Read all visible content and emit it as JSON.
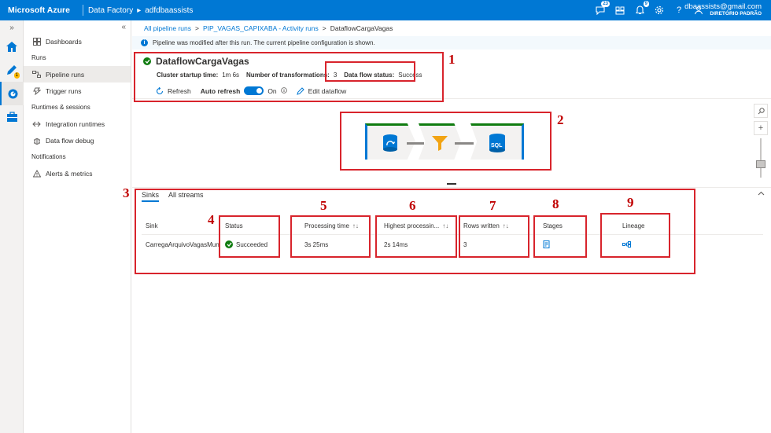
{
  "topbar": {
    "brand": "Microsoft Azure",
    "service": "Data Factory",
    "factory": "adfdbaassists",
    "notification_counts": {
      "messages": "23",
      "alerts": "9"
    },
    "user_email": "dbaassists@gmail.com",
    "user_directory": "DIRETÓRIO PADRÃO"
  },
  "rail": {
    "pen_badge": "1"
  },
  "nav": {
    "collapse": "«",
    "expand": "»",
    "items": [
      {
        "label": "Dashboards"
      },
      {
        "group": "Runs"
      },
      {
        "label": "Pipeline runs"
      },
      {
        "label": "Trigger runs"
      },
      {
        "group": "Runtimes & sessions"
      },
      {
        "label": "Integration runtimes"
      },
      {
        "label": "Data flow debug"
      },
      {
        "group": "Notifications"
      },
      {
        "label": "Alerts & metrics"
      }
    ]
  },
  "breadcrumb": {
    "items": [
      "All pipeline runs",
      "PIP_VAGAS_CAPIXABA - Activity runs",
      "DataflowCargaVagas"
    ],
    "separator": ">"
  },
  "info_message": "Pipeline was modified after this run. The current pipeline configuration is shown.",
  "header": {
    "title": "DataflowCargaVagas",
    "startup_label": "Cluster startup time:",
    "startup_value": "1m 6s",
    "transformations_label": "Number of transformations:",
    "transformations_value": "3",
    "status_label": "Data flow status:",
    "status_value": "Success"
  },
  "toolbar": {
    "refresh": "Refresh",
    "auto_refresh": "Auto refresh",
    "toggle_state": "On",
    "edit": "Edit dataflow"
  },
  "dataflow": {
    "sink_label": "SQL"
  },
  "panel": {
    "tabs": [
      "Sinks",
      "All streams"
    ],
    "columns": [
      "Sink",
      "Status",
      "Processing time",
      "Highest processin...",
      "Rows written",
      "Stages",
      "Lineage"
    ],
    "rows": [
      {
        "sink": "CarregaArquivoVagasMun",
        "status": "Succeeded",
        "processing_time": "3s 25ms",
        "highest_processing": "2s 14ms",
        "rows_written": "3"
      }
    ]
  },
  "annotations": [
    "1",
    "2",
    "3",
    "4",
    "5",
    "6",
    "7",
    "8",
    "9"
  ],
  "colors": {
    "azure_blue": "#0078d4",
    "success_green": "#107c10",
    "annotation_red": "#d8242c"
  }
}
